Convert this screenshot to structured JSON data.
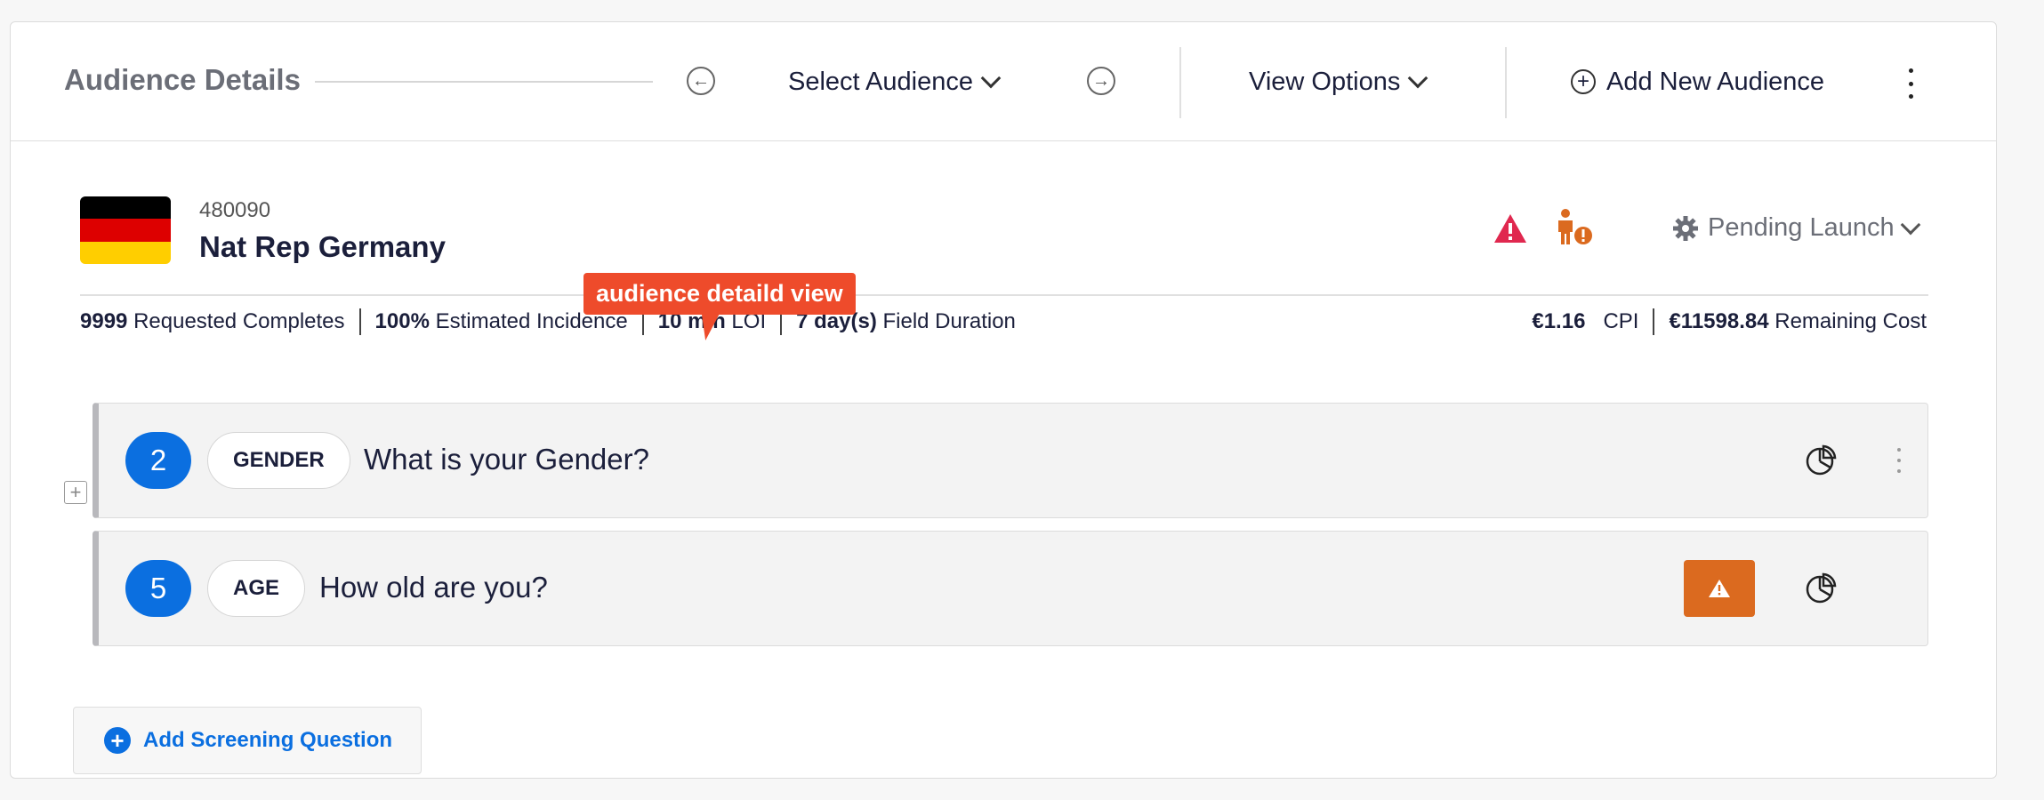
{
  "header": {
    "title": "Audience Details",
    "prev_icon": "arrow-left-circle-icon",
    "select_audience": "Select Audience",
    "next_icon": "arrow-right-circle-icon",
    "view_options": "View Options",
    "add_new_audience": "Add New Audience"
  },
  "audience": {
    "id": "480090",
    "name": "Nat Rep Germany",
    "flag_colors": [
      "#000000",
      "#dd0000",
      "#ffce00"
    ],
    "status": "Pending Launch",
    "stats": {
      "requested_completes_value": "9999",
      "requested_completes_label": "Requested Completes",
      "incidence_value": "100%",
      "incidence_label": "Estimated Incidence",
      "loi_value": "10 min",
      "loi_label": "LOI",
      "field_duration_value": "7 day(s)",
      "field_duration_label": "Field Duration",
      "cpi_value": "€1.16",
      "cpi_label": "CPI",
      "remaining_cost_value": "€11598.84",
      "remaining_cost_label": "Remaining Cost"
    }
  },
  "tooltip": {
    "text": "audience detaild view"
  },
  "questions": [
    {
      "number": "2",
      "tag": "GENDER",
      "text": "What is your Gender?"
    },
    {
      "number": "5",
      "tag": "AGE",
      "text": "How old are you?"
    }
  ],
  "add_screening": {
    "label": "Add Screening Question"
  },
  "colors": {
    "accent": "#0b6fe0",
    "warning": "#db6a1f",
    "alert": "#e0284f",
    "tooltip": "#ee4b2b"
  }
}
